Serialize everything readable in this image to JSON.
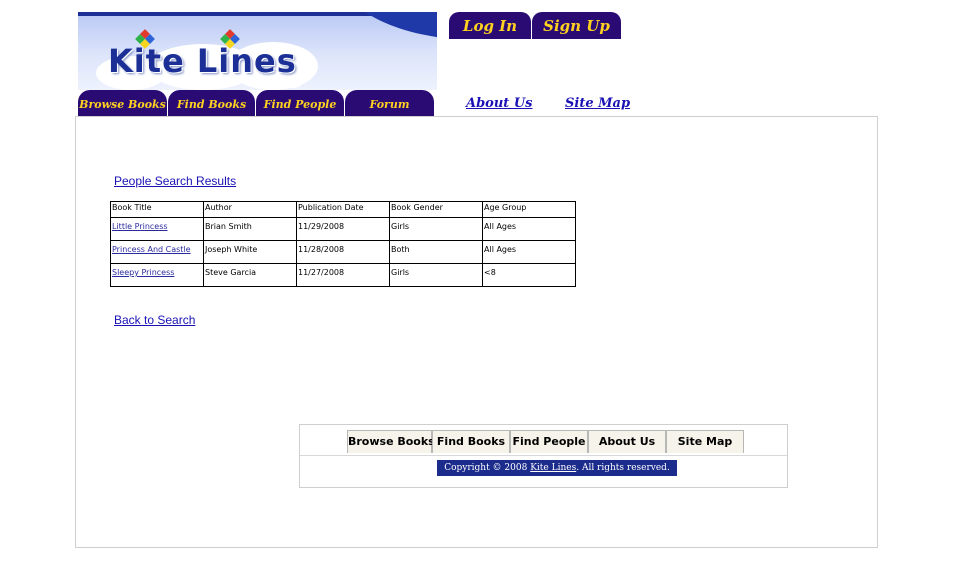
{
  "logo": {
    "text": "Kite Lines"
  },
  "auth": {
    "login_label": "Log In",
    "signup_label": "Sign Up"
  },
  "nav": {
    "tabs": [
      {
        "label": "Browse Books"
      },
      {
        "label": "Find Books"
      },
      {
        "label": "Find People"
      },
      {
        "label": "Forum"
      }
    ],
    "side_links": [
      {
        "label": "About Us"
      },
      {
        "label": "Site Map"
      }
    ]
  },
  "main": {
    "heading_link": "People Search Results",
    "back_link": "Back to Search",
    "table": {
      "headers": [
        "Book Title",
        "Author",
        "Publication Date",
        "Book Gender",
        "Age Group"
      ],
      "rows": [
        [
          "Little Princess",
          "Brian Smith",
          "11/29/2008",
          "Girls",
          "All Ages"
        ],
        [
          "Princess And Castle",
          "Joseph White",
          "11/28/2008",
          "Both",
          "All Ages"
        ],
        [
          "Sleepy Princess",
          "Steve Garcia",
          "11/27/2008",
          "Girls",
          "<8"
        ]
      ]
    }
  },
  "footer": {
    "tabs": [
      {
        "label": "Browse Books"
      },
      {
        "label": "Find Books"
      },
      {
        "label": "Find People"
      },
      {
        "label": "About Us"
      },
      {
        "label": "Site Map"
      }
    ],
    "copyright_prefix": "Copyright © 2008",
    "copyright_link": "Kite Lines",
    "copyright_suffix": ". All rights reserved."
  },
  "colors": {
    "nav_bg": "#2a0a73",
    "nav_text": "#ffd21f",
    "link": "#1a12b5",
    "copyright_bg": "#1c2c8c"
  }
}
